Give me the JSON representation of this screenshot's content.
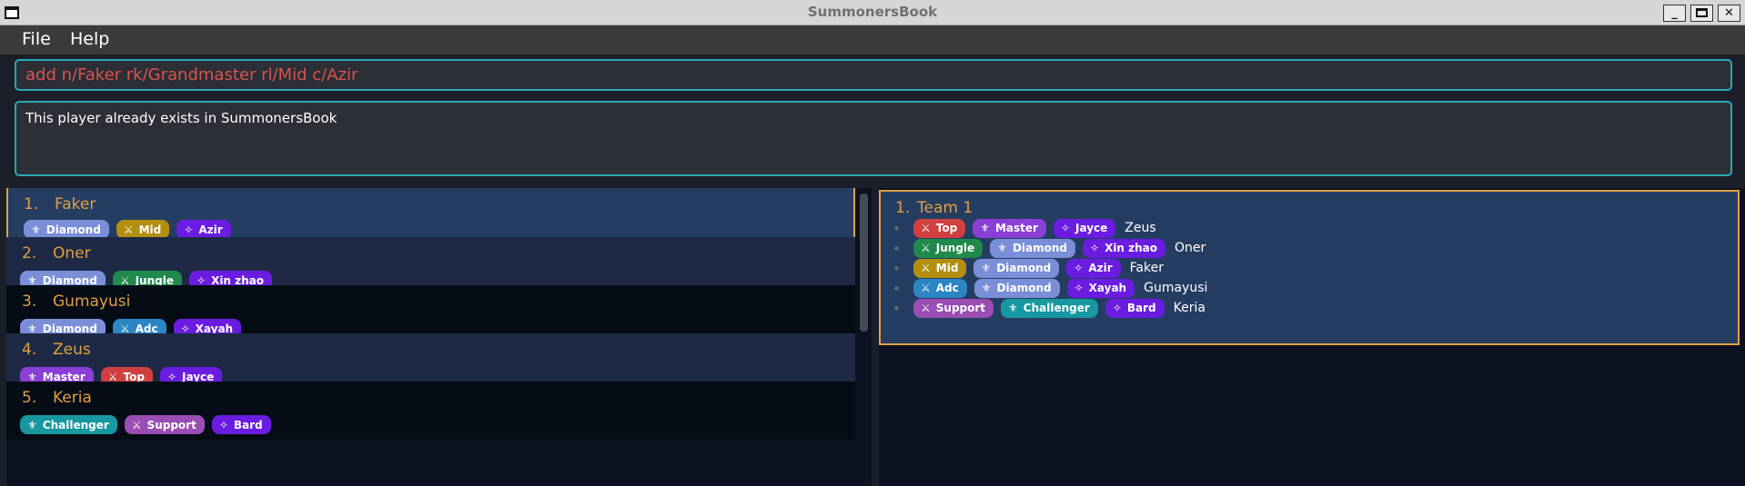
{
  "window": {
    "title": "SummonersBook",
    "minimize": "_",
    "close": "✕"
  },
  "menu": {
    "file": "File",
    "help": "Help"
  },
  "command_box": {
    "value": "add n/Faker rk/Grandmaster rl/Mid c/Azir"
  },
  "result_box": {
    "text": "This player already exists in SummonersBook"
  },
  "players": [
    {
      "index": "1.",
      "name": "Faker",
      "rank": "Diamond",
      "role": "Mid",
      "champion": "Azir"
    },
    {
      "index": "2.",
      "name": "Oner",
      "rank": "Diamond",
      "role": "Jungle",
      "champion": "Xin zhao"
    },
    {
      "index": "3.",
      "name": "Gumayusi",
      "rank": "Diamond",
      "role": "Adc",
      "champion": "Xayah"
    },
    {
      "index": "4.",
      "name": "Zeus",
      "rank": "Master",
      "role": "Top",
      "champion": "Jayce"
    },
    {
      "index": "5.",
      "name": "Keria",
      "rank": "Challenger",
      "role": "Support",
      "champion": "Bard"
    }
  ],
  "teams": [
    {
      "index": "1.",
      "name": "Team 1",
      "members": [
        {
          "role": "Top",
          "rank": "Master",
          "champion": "Jayce",
          "name": "Zeus"
        },
        {
          "role": "Jungle",
          "rank": "Diamond",
          "champion": "Xin zhao",
          "name": "Oner"
        },
        {
          "role": "Mid",
          "rank": "Diamond",
          "champion": "Azir",
          "name": "Faker"
        },
        {
          "role": "Adc",
          "rank": "Diamond",
          "champion": "Xayah",
          "name": "Gumayusi"
        },
        {
          "role": "Support",
          "rank": "Challenger",
          "champion": "Bard",
          "name": "Keria"
        }
      ]
    }
  ],
  "icons": {
    "rank": "⚜",
    "role": "⚔",
    "champion": "✧"
  },
  "colors": {
    "accent": "#e0a040",
    "border": "#2aa8b8",
    "error_text": "#d9534f"
  }
}
